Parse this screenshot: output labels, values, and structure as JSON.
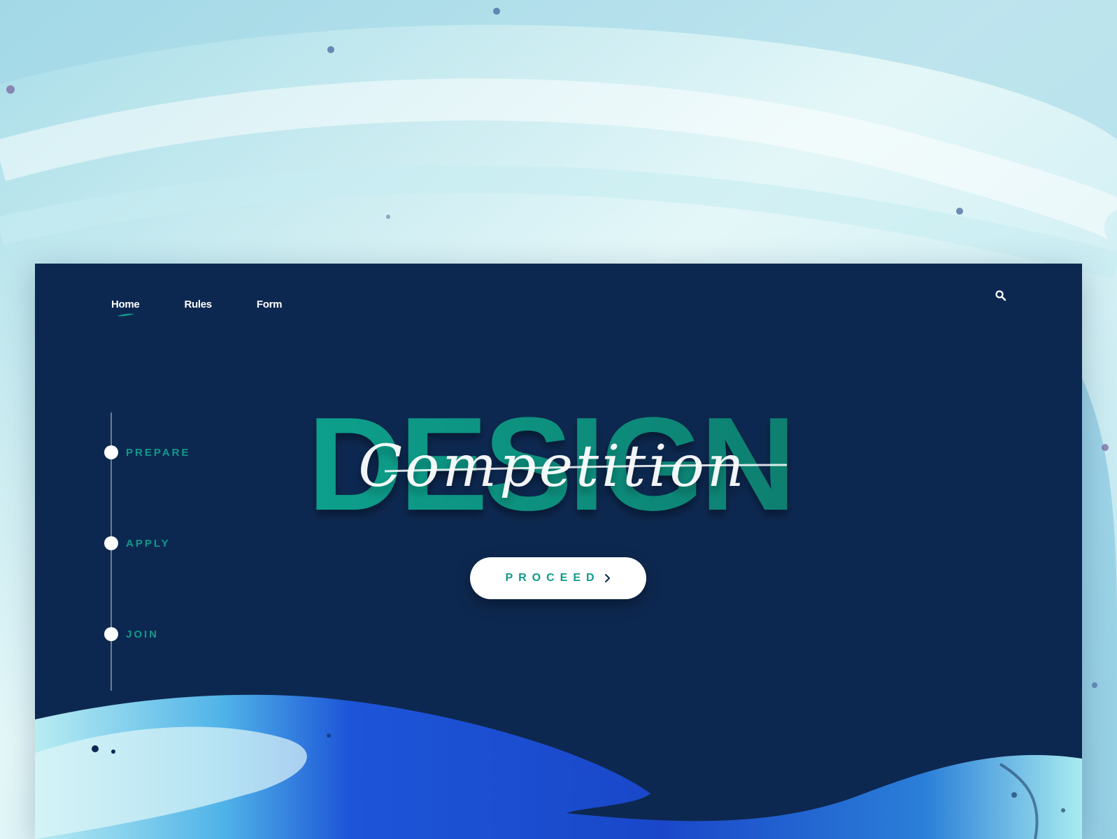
{
  "nav": {
    "items": [
      {
        "label": "Home",
        "active": true
      },
      {
        "label": "Rules",
        "active": false
      },
      {
        "label": "Form",
        "active": false
      }
    ]
  },
  "hero": {
    "title": "DESIGN",
    "script": "Competition",
    "button_label": "PROCEED"
  },
  "steps": [
    {
      "label": "PREPARE"
    },
    {
      "label": "APPLY"
    },
    {
      "label": "JOIN"
    }
  ],
  "icons": {
    "search": "search-icon",
    "active_nav": "brush-underline-icon",
    "proceed": "chevron-right-icon"
  },
  "colors": {
    "card_bg": "#0d2850",
    "accent": "#0f9a8a",
    "white": "#ffffff"
  }
}
